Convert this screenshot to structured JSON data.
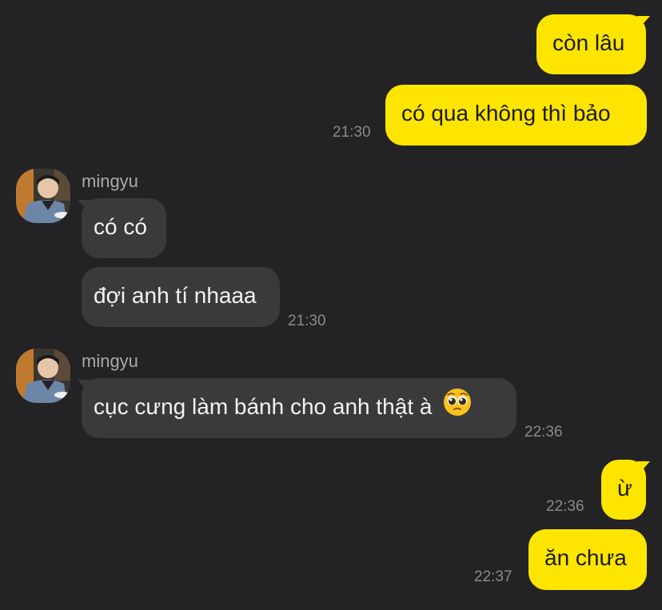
{
  "chat": {
    "colors": {
      "background": "#232325",
      "outgoing_bubble": "#fee500",
      "incoming_bubble": "#3a3a3c",
      "timestamp": "#8a8a8e"
    },
    "messages": {
      "m1": {
        "text": "còn lâu"
      },
      "m2": {
        "text": "có qua không thì bảo",
        "time": "21:30"
      },
      "g1": {
        "sender": "mingyu",
        "avatar_icon": "profile-photo-icon"
      },
      "m3": {
        "text": "có có"
      },
      "m4": {
        "text": "đợi anh tí nhaaa",
        "time": "21:30"
      },
      "g2": {
        "sender": "mingyu",
        "avatar_icon": "profile-photo-icon"
      },
      "m5": {
        "text": "cục cưng làm bánh cho anh thật à",
        "emoji": "pleading-face-emoji",
        "time": "22:36"
      },
      "m6": {
        "text": "ừ",
        "time": "22:36"
      },
      "m7": {
        "text": "ăn chưa",
        "time": "22:37"
      }
    }
  }
}
